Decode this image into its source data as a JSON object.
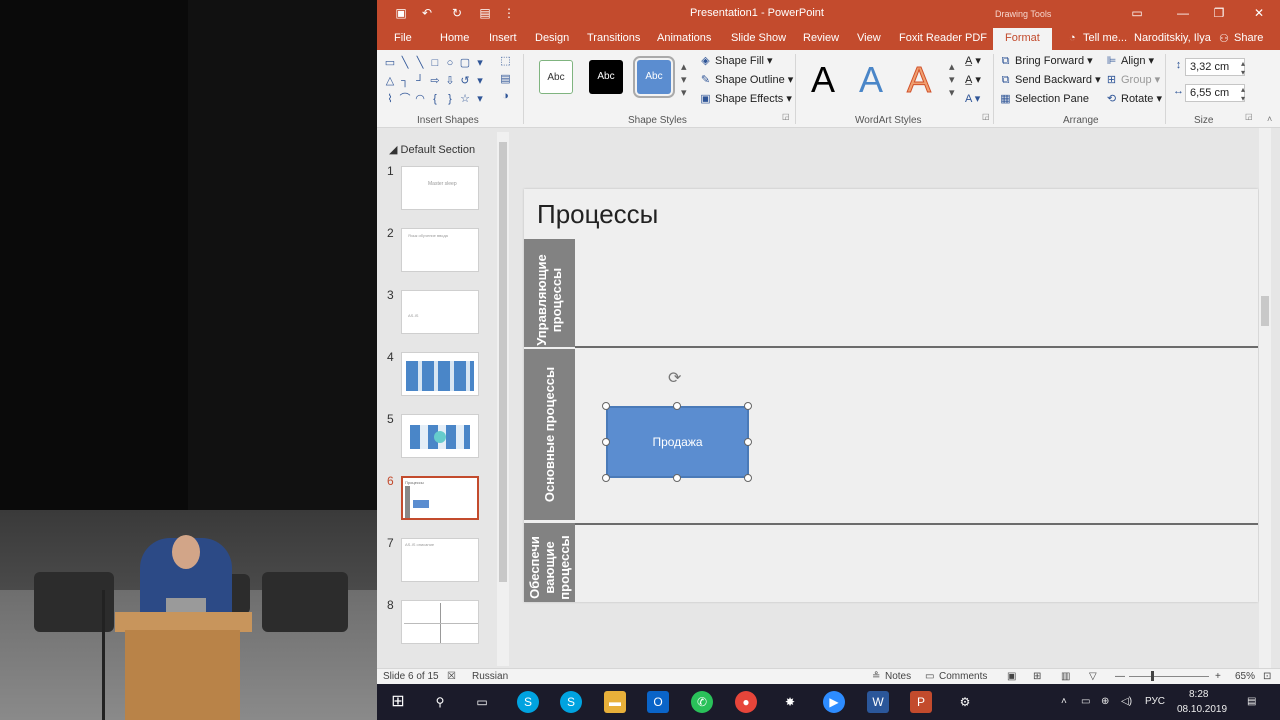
{
  "window": {
    "title": "Presentation1 - PowerPoint",
    "contextual_title": "Drawing Tools"
  },
  "tabs": [
    "File",
    "Home",
    "Insert",
    "Design",
    "Transitions",
    "Animations",
    "Slide Show",
    "Review",
    "View",
    "Foxit Reader PDF",
    "Format"
  ],
  "tabs_right": {
    "tell_me": "Tell me...",
    "user": "Naroditskiy, Ilya",
    "share": "Share"
  },
  "ribbon": {
    "groups": {
      "insert_shapes": "Insert Shapes",
      "shape_styles": "Shape Styles",
      "wordart_styles": "WordArt Styles",
      "arrange": "Arrange",
      "size": "Size"
    },
    "style_samples": [
      "Abc",
      "Abc",
      "Abc"
    ],
    "shape_fill": "Shape Fill",
    "shape_outline": "Shape Outline",
    "shape_effects": "Shape Effects",
    "wordart": [
      "A",
      "A",
      "A"
    ],
    "bring_forward": "Bring Forward",
    "send_backward": "Send Backward",
    "selection_pane": "Selection Pane",
    "align": "Align",
    "group": "Group",
    "rotate": "Rotate",
    "height": "3,32 cm",
    "width": "6,55 cm"
  },
  "thumbnails": {
    "section": "Default Section",
    "slides": [
      {
        "num": "1",
        "caption": "Master sleep"
      },
      {
        "num": "2",
        "caption": "Язык обучение ввода"
      },
      {
        "num": "3",
        "caption": "AS-IS"
      },
      {
        "num": "4",
        "caption": ""
      },
      {
        "num": "5",
        "caption": ""
      },
      {
        "num": "6",
        "caption": "Процессы"
      },
      {
        "num": "7",
        "caption": "AS-IS описание"
      },
      {
        "num": "8",
        "caption": ""
      }
    ]
  },
  "slide": {
    "title": "Процессы",
    "lanes": [
      "Управляющие процессы",
      "Основные процессы",
      "Обеспечи вающие процессы"
    ],
    "process_box": "Продажа"
  },
  "status": {
    "slide_of": "Slide 6 of 15",
    "language": "Russian",
    "notes": "Notes",
    "comments": "Comments",
    "zoom": "65%"
  },
  "taskbar": {
    "lang": "РУС",
    "time": "8:28",
    "date": "08.10.2019"
  },
  "colors": {
    "accent": "#c34b2d",
    "process_fill": "#5b8dd0",
    "lane_head": "#828282"
  }
}
